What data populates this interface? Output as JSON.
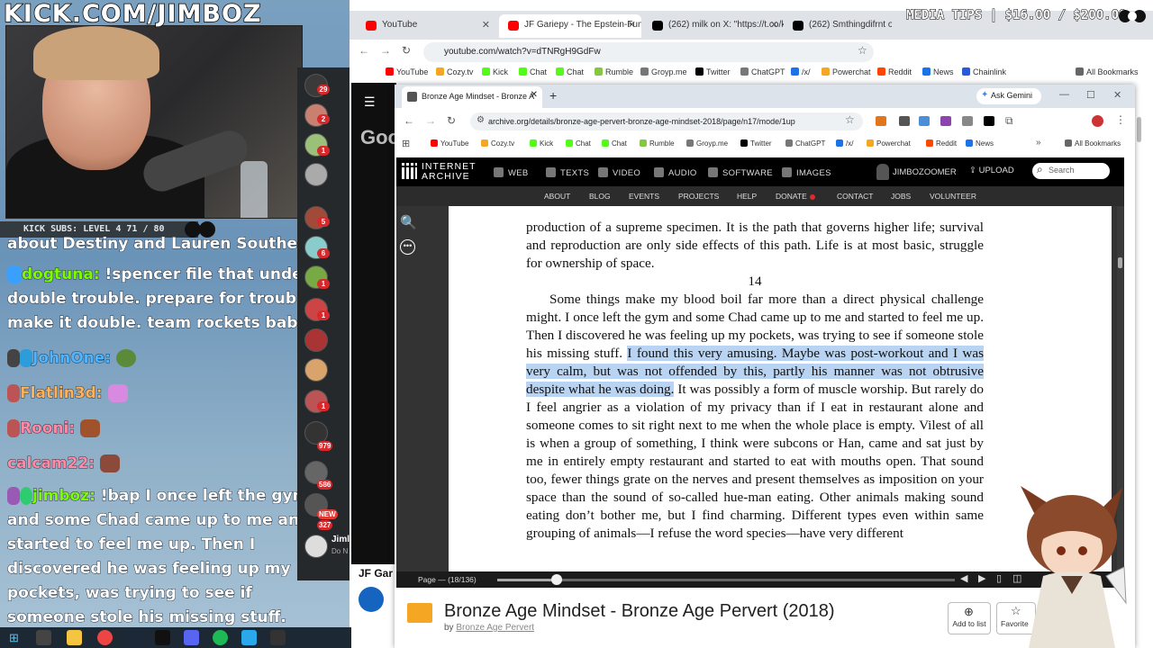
{
  "stream": {
    "title": "KICK.COM/JIMBOZ",
    "media_tips": "MEDIA TIPS | $16.00 / $200.00",
    "kick_subs": "KICK SUBS: LEVEL 4 71 / 80",
    "chat": [
      {
        "user": "",
        "text": "about Destiny and Lauren Southern"
      },
      {
        "user": "dogtuna:",
        "text": "!spencer file that under double trouble. prepare for trouble, make it double. team rockets baby"
      },
      {
        "user": "JohnOne:",
        "text": ""
      },
      {
        "user": "Flatlin3d:",
        "text": ""
      },
      {
        "user": "Rooni:",
        "text": ""
      },
      {
        "user": "calcam22:",
        "text": ""
      },
      {
        "user": "jimboz:",
        "text": "!bap I once left the gym and some Chad came up to me and started to feel me up. Then I discovered he was feeling up my pockets, was trying to see if someone stole his missing stuff."
      }
    ],
    "rail_badges": [
      "29",
      "2",
      "1",
      "5",
      "6",
      "1",
      "1",
      "1",
      "979",
      "586",
      "327"
    ],
    "new_badge": "NEW",
    "rail_name": "Jiml",
    "rail_sub": "Do N"
  },
  "back_browser": {
    "tabs": [
      {
        "label": "YouTube",
        "color": "#ff0000"
      },
      {
        "label": "JF Gariepy - The Epstein-Funde",
        "color": "#ff0000"
      },
      {
        "label": "(262) milk on X: \"https://t.co/k",
        "color": "#000000"
      },
      {
        "label": "(262) Smthingdifrnt on X",
        "color": "#000000"
      }
    ],
    "url": "youtube.com/watch?v=dTNRgH9GdFw",
    "bookmarks": [
      "YouTube",
      "Cozy.tv",
      "Kick",
      "Chat",
      "Chat",
      "Rumble",
      "Groyp.me",
      "Twitter",
      "ChatGPT",
      "/x/",
      "Powerchat",
      "Reddit",
      "News",
      "Chainlink"
    ],
    "all_bookmarks": "All Bookmarks",
    "yt_logo_partial": "Goo",
    "yt_video_title": "JF Gar"
  },
  "front_browser": {
    "tab_label": "Bronze Age Mindset - Bronze A",
    "ask_gemini": "Ask Gemini",
    "url": "archive.org/details/bronze-age-pervert-bronze-age-mindset-2018/page/n17/mode/1up",
    "bookmarks": [
      "YouTube",
      "Cozy.tv",
      "Kick",
      "Chat",
      "Chat",
      "Rumble",
      "Groyp.me",
      "Twitter",
      "ChatGPT",
      "/x/",
      "Powerchat",
      "Reddit",
      "News"
    ],
    "all_bookmarks": "All Bookmarks"
  },
  "archive": {
    "logo_line1": "INTERNET",
    "logo_line2": "ARCHIVE",
    "nav": [
      "WEB",
      "TEXTS",
      "VIDEO",
      "AUDIO",
      "SOFTWARE",
      "IMAGES"
    ],
    "user": "JIMBOZOOMER",
    "upload": "UPLOAD",
    "search_placeholder": "Search",
    "subnav": [
      "ABOUT",
      "BLOG",
      "EVENTS",
      "PROJECTS",
      "HELP",
      "DONATE",
      "CONTACT",
      "JOBS",
      "VOLUNTEER"
    ],
    "page_text_top": "production of a supreme specimen. It is the path that governs higher life; survival and reproduction are only side effects of this path. Life is at most basic, struggle for ownership of space.",
    "page_number": "14",
    "para_before": "Some things make my blood boil far more than a direct physical challenge might. I once left the gym and some Chad came up to me and started to feel me up. Then I discovered he was feeling up my pockets, was trying to see if someone stole his missing stuff. ",
    "para_highlight": "I found this very amusing. Maybe was post-workout and I was very calm, but was not offended by this, partly his manner was not obtrusive despite what he was doing.",
    "para_after": " It was possibly a form of muscle worship. But rarely do I feel angrier as a violation of my privacy than if I eat in restaurant alone and someone comes to sit right next to me when the whole place is empty. Vilest of all is when a group of something, I think were subcons or Han, came and sat just by me in entirely empty restaurant and started to eat with mouths open. That sound too, fewer things grate on the nerves and present themselves as imposition on your space than the sound of so-called hue-man eating. Other animals making sound eating don’t bother me, but I find charming. Different types even within same grouping of animals—I refuse the word species—have very different",
    "page_label": "Page — (18/136)",
    "page_progress": 0.13,
    "book_title": "Bronze Age Mindset - Bronze Age Pervert (2018)",
    "by_label": "by",
    "author": "Bronze Age Pervert",
    "add_to_list": "Add to list",
    "favorite": "Favorite"
  }
}
